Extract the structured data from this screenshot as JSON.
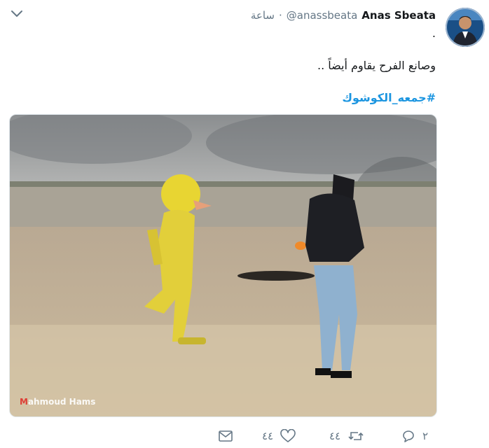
{
  "tweet": {
    "author_name": "Anas Sbeata",
    "handle": "@anassbeata",
    "separator": "·",
    "time": "ساعة",
    "text_line1": ".",
    "text_line2": "وصانع الفرح يقاوم أيضاً ..",
    "hashtag": "#جمعه_الكوشوك"
  },
  "photo": {
    "watermark_prefix": "M",
    "watermark_rest": "ahmoud Hams"
  },
  "actions": {
    "reply_count": "٢",
    "retweet_count": "٤٤",
    "like_count": "٤٤"
  },
  "colors": {
    "accent": "#1b95e0",
    "muted": "#657786",
    "text": "#14171a"
  }
}
